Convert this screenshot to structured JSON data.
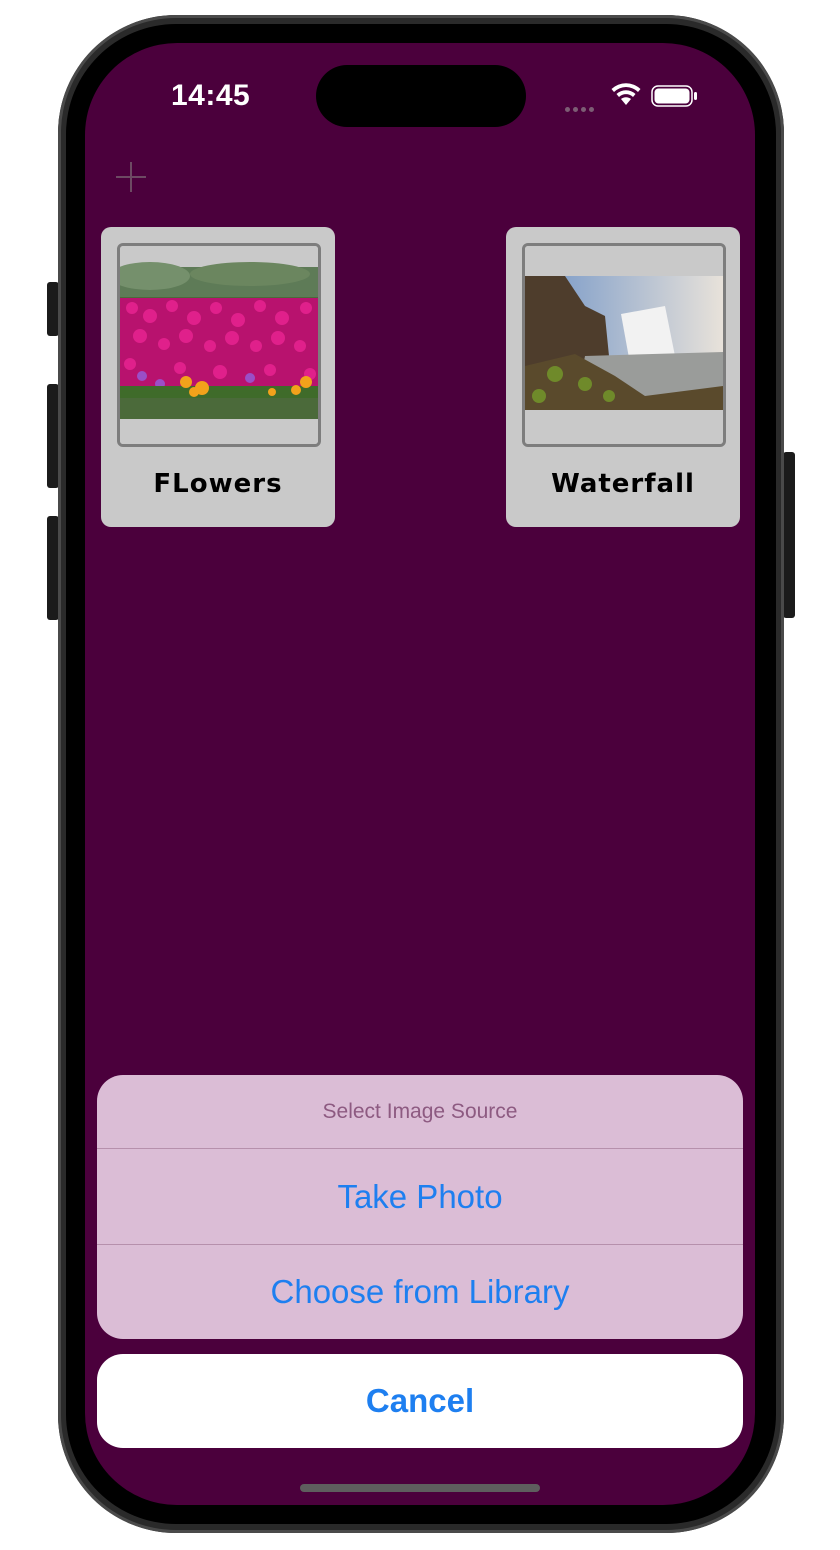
{
  "status_bar": {
    "time": "14:45"
  },
  "toolbar": {
    "add_icon": "plus-icon"
  },
  "cards": [
    {
      "label": "FLowers"
    },
    {
      "label": "Waterfall"
    }
  ],
  "action_sheet": {
    "title": "Select Image Source",
    "take_photo": "Take Photo",
    "choose_library": "Choose from Library",
    "cancel": "Cancel"
  },
  "colors": {
    "background": "#4b003c",
    "card": "#c9c9c9",
    "sheet": "#dbbdd6",
    "accent": "#1e7ff0"
  }
}
